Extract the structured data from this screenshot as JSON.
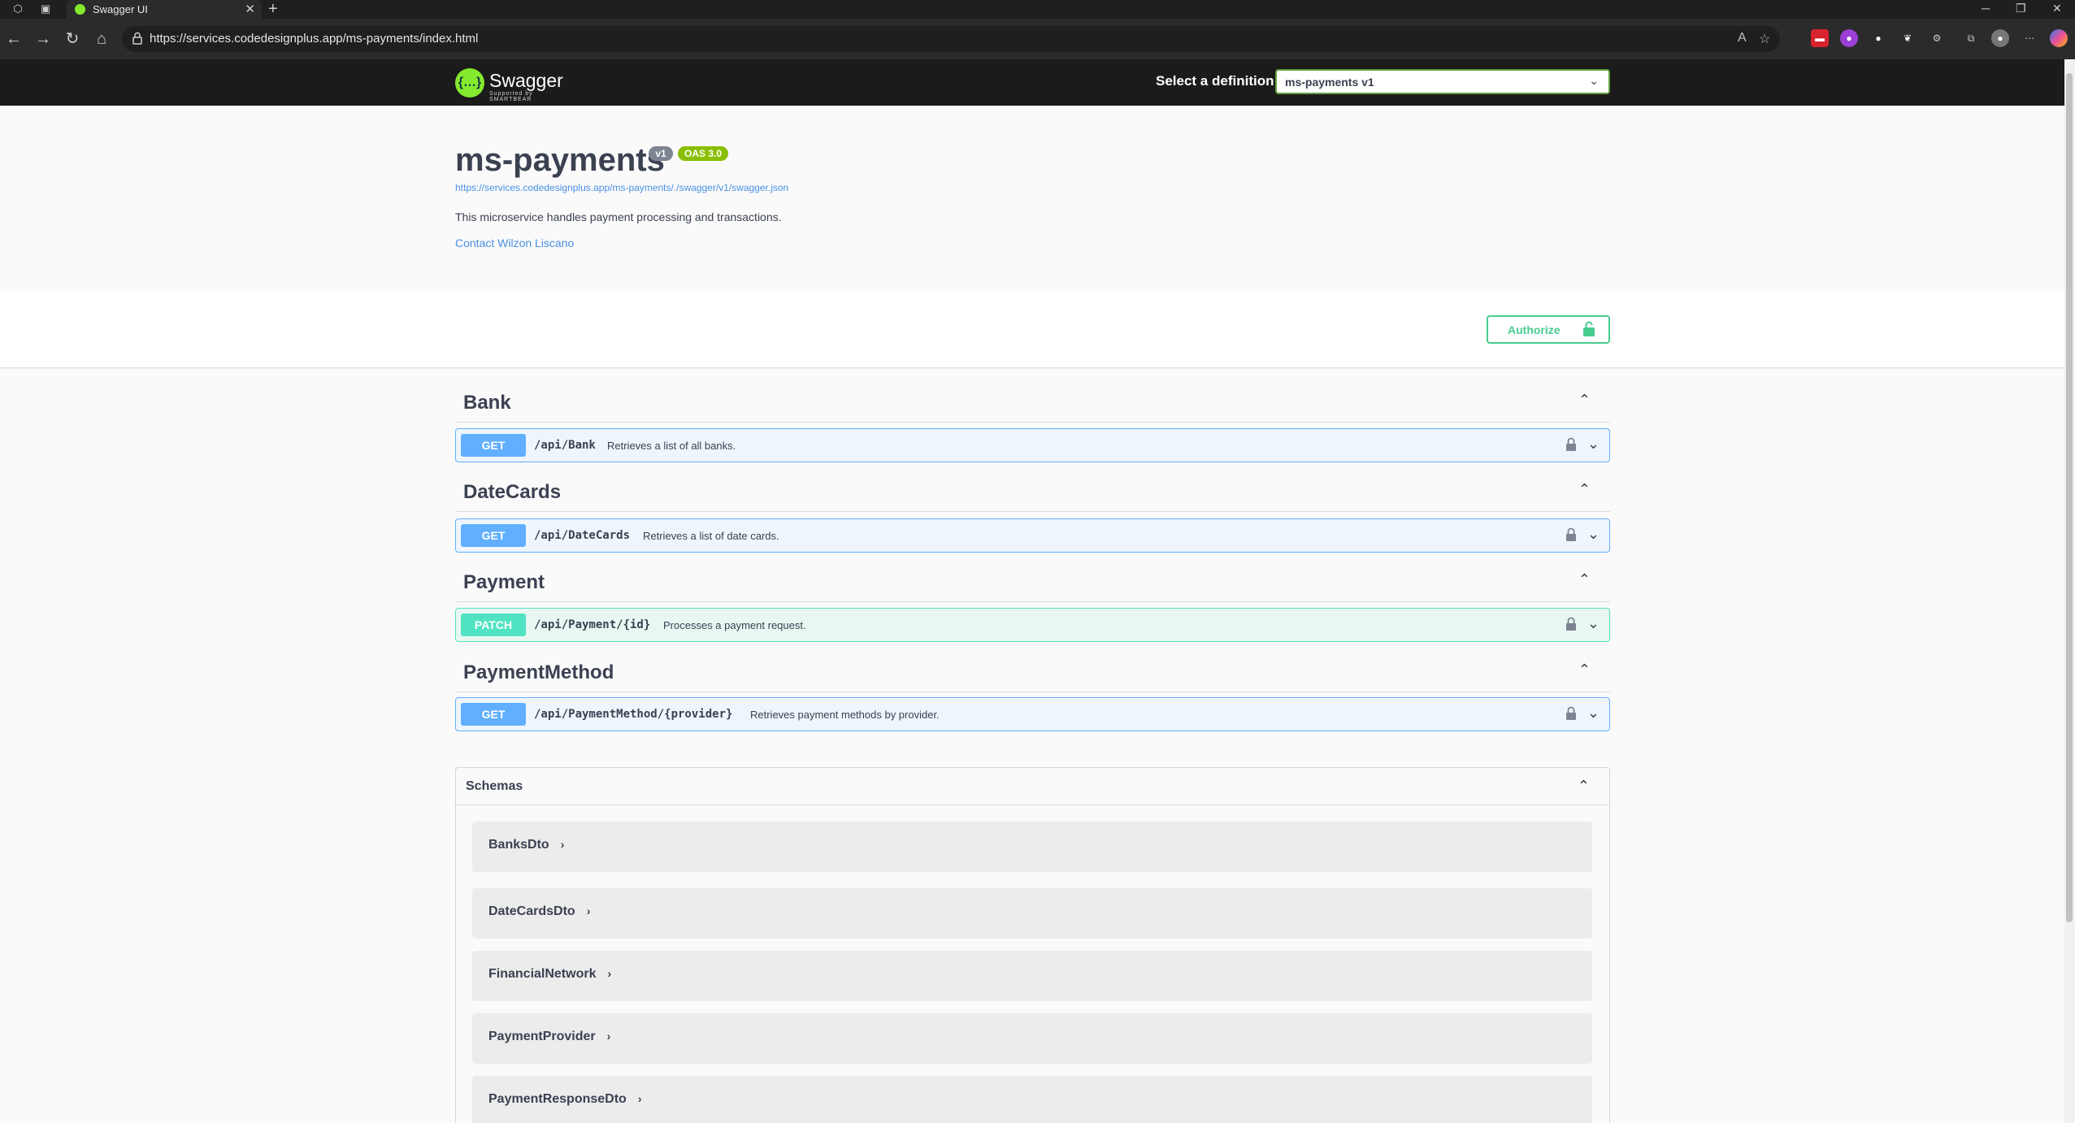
{
  "browser": {
    "tab_title": "Swagger UI",
    "tab_close": "✕",
    "new_tab": "+",
    "url": "https://services.codedesignplus.app/ms-payments/index.html"
  },
  "topbar": {
    "logo_text": "Swagger",
    "logo_sub": "Supported by SMARTBEAR",
    "select_label": "Select a definition",
    "selected_definition": "ms-payments v1"
  },
  "info": {
    "title": "ms-payments",
    "version_badge": "v1",
    "oas_badge": "OAS 3.0",
    "spec_url": "https://services.codedesignplus.app/ms-payments/./swagger/v1/swagger.json",
    "description": "This microservice handles payment processing and transactions.",
    "contact": "Contact Wilzon Liscano"
  },
  "authorize": {
    "label": "Authorize"
  },
  "tags": [
    {
      "name": "Bank",
      "method": "GET",
      "path": "/api/Bank",
      "summary": "Retrieves a list of all banks."
    },
    {
      "name": "DateCards",
      "method": "GET",
      "path": "/api/DateCards",
      "summary": "Retrieves a list of date cards."
    },
    {
      "name": "Payment",
      "method": "PATCH",
      "path": "/api/Payment/{id}",
      "summary": "Processes a payment request."
    },
    {
      "name": "PaymentMethod",
      "method": "GET",
      "path": "/api/PaymentMethod/{provider}",
      "summary": "Retrieves payment methods by provider."
    }
  ],
  "schemas": {
    "title": "Schemas",
    "models": [
      "BanksDto",
      "DateCardsDto",
      "FinancialNetwork",
      "PaymentProvider",
      "PaymentResponseDto"
    ]
  },
  "colors": {
    "get": "#61affe",
    "patch": "#50e3c2",
    "authorize": "#49cc90",
    "swagger_green": "#85ea2d"
  }
}
